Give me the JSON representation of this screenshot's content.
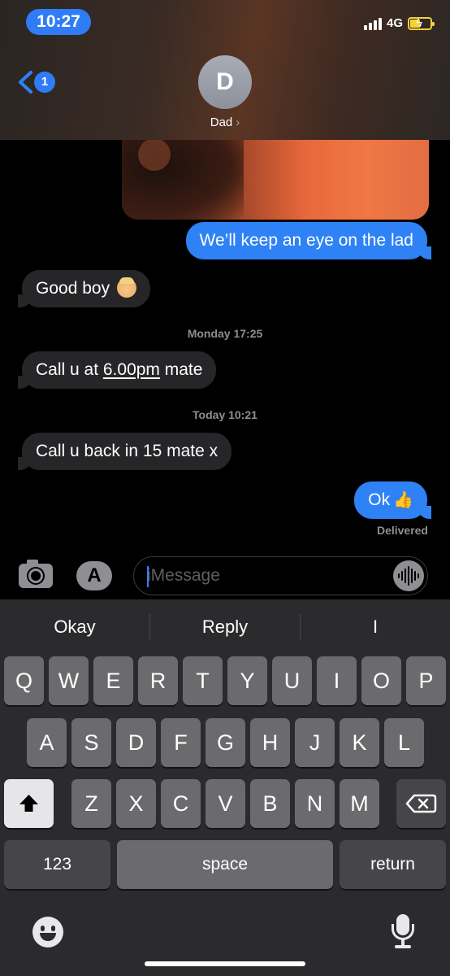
{
  "status_bar": {
    "time": "10:27",
    "network": "4G"
  },
  "header": {
    "back_count": "1",
    "avatar_initial": "D",
    "contact_name": "Dad",
    "contact_chevron": "›"
  },
  "messages": [
    {
      "direction": "out",
      "text": "We’ll keep an eye on the lad"
    },
    {
      "direction": "in",
      "text": "Good boy",
      "emoji": "boy-emoji"
    },
    {
      "direction": "in",
      "text_before": "Call u at ",
      "link": "6.00pm",
      "text_after": " mate"
    },
    {
      "direction": "in",
      "text": "Call u back in 15 mate x"
    },
    {
      "direction": "out",
      "text": "Ok",
      "emoji": "thumbs-up-emoji"
    }
  ],
  "timestamps": [
    {
      "day": "Monday",
      "time": "17:25"
    },
    {
      "day": "Today",
      "time": "10:21"
    }
  ],
  "delivery_status": "Delivered",
  "composer": {
    "placeholder": "iMessage"
  },
  "keyboard": {
    "suggestions": [
      "Okay",
      "Reply",
      "I"
    ],
    "row1": [
      "Q",
      "W",
      "E",
      "R",
      "T",
      "Y",
      "U",
      "I",
      "O",
      "P"
    ],
    "row2": [
      "A",
      "S",
      "D",
      "F",
      "G",
      "H",
      "J",
      "K",
      "L"
    ],
    "row3": [
      "Z",
      "X",
      "C",
      "V",
      "B",
      "N",
      "M"
    ],
    "numbers_label": "123",
    "space_label": "space",
    "return_label": "return"
  },
  "colors": {
    "accent": "#2f82f6",
    "incoming": "#262628",
    "battery": "#f4d23c"
  }
}
